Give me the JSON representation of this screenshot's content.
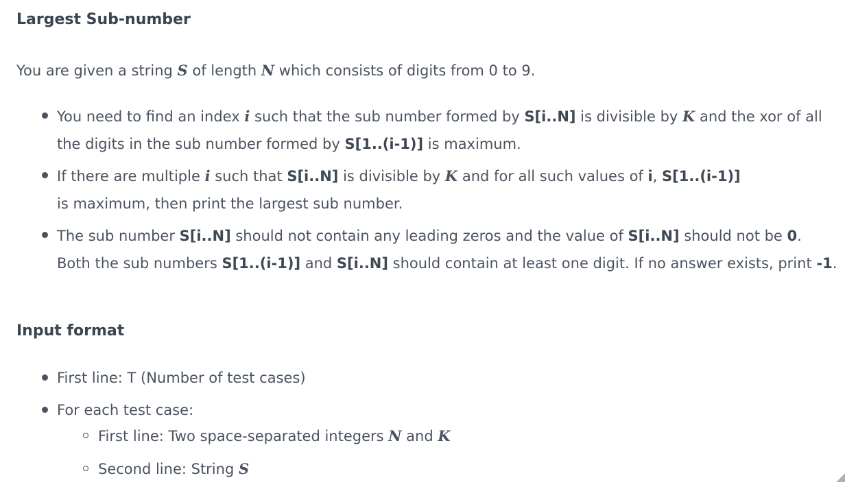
{
  "title": "Largest Sub-number",
  "intro": {
    "t1": "You are given a string ",
    "v1": "S",
    "t2": " of length ",
    "v2": "N",
    "t3": " which consists of digits from 0 to 9."
  },
  "bullets": [
    {
      "a": "You need to find an index ",
      "i": "i",
      "b": " such that the sub number formed by ",
      "c": "S[i..N]",
      "d": " is divisible by ",
      "k": "K",
      "e": " and the xor of all the digits in the sub number formed by ",
      "f": "S[1..(i-1)]",
      "g": " is maximum."
    },
    {
      "a": "If there are multiple ",
      "i": "i",
      "b": " such that ",
      "c": "S[i..N]",
      "d": " is divisible by ",
      "k": "K",
      "e": " and for all such values of ",
      "i2": "i",
      "comma": ", ",
      "f": "S[1..(i-1)]",
      "g": "is maximum, then print the largest sub number."
    },
    {
      "a": "The sub number ",
      "c": "S[i..N]",
      "b": " should not contain any leading zeros and the value of ",
      "c2": "S[i..N]",
      "d": " should not be ",
      "zero": "0",
      "e": ". Both the sub numbers ",
      "f": "S[1..(i-1)]",
      "and": " and ",
      "c3": "S[i..N]",
      "g": " should contain at least one digit. If no answer exists, print ",
      "neg": "-1",
      "h": "."
    }
  ],
  "input_format": {
    "heading": "Input format",
    "item1": "First line: T (Number of test cases)",
    "item2": "For each test case:",
    "sub1_a": "First line: Two space-separated integers ",
    "sub1_n": "N",
    "sub1_and": " and ",
    "sub1_k": "K",
    "sub2_a": "Second line: String ",
    "sub2_s": "S"
  }
}
